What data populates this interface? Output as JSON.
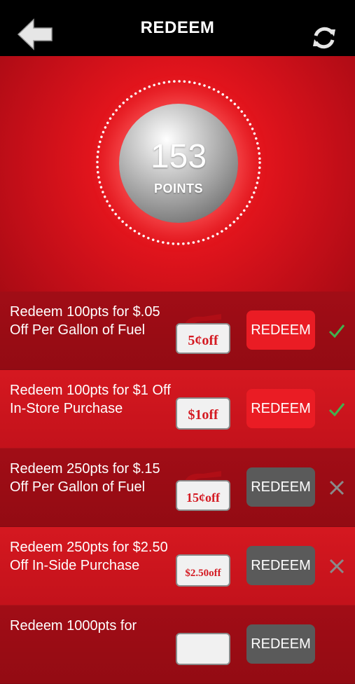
{
  "header": {
    "title": "REDEEM"
  },
  "points": {
    "value": "153",
    "label": "POINTS"
  },
  "rewards": [
    {
      "desc": "Redeem 100pts for $.05 Off Per Gallon of Fuel",
      "coupon_text": "5¢off",
      "button": "REDEEM",
      "available": true
    },
    {
      "desc": "Redeem 100pts for $1 Off In-Store Purchase",
      "coupon_text": "$1off",
      "button": "REDEEM",
      "available": true
    },
    {
      "desc": "Redeem 250pts for $.15 Off Per Gallon of Fuel",
      "coupon_text": "15¢off",
      "button": "REDEEM",
      "available": false
    },
    {
      "desc": "Redeem 250pts for $2.50 Off In-Side Purchase",
      "coupon_text": "$2.50off",
      "button": "REDEEM",
      "available": false
    },
    {
      "desc": "Redeem 1000pts for",
      "coupon_text": "",
      "button": "REDEEM",
      "available": false
    }
  ],
  "colors": {
    "accent": "#ea1c24",
    "disabled": "#5a5a5a",
    "check": "#3fb34f",
    "cross": "#8a8a8a"
  }
}
